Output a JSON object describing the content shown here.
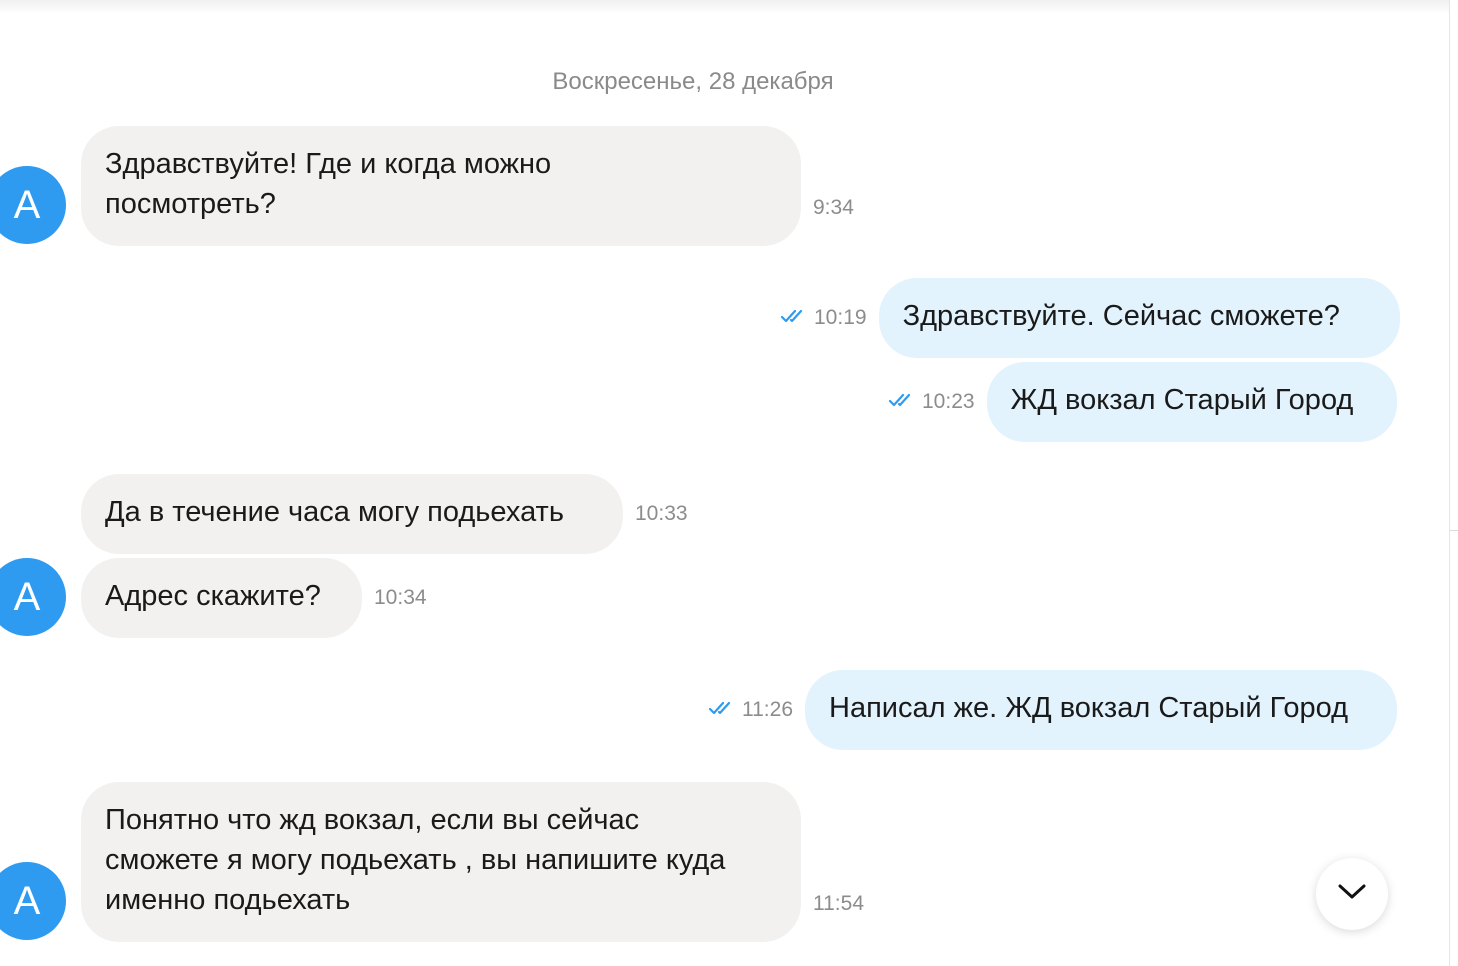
{
  "date_divider": "Воскресенье, 28 декабря",
  "avatar_letter": "А",
  "colors": {
    "avatar": "#2f9bf0",
    "incoming_bubble": "#f2f1f0",
    "outgoing_bubble": "#e2f3fd",
    "read_check": "#2f9bf0"
  },
  "messages": [
    {
      "direction": "incoming",
      "text_lines": [
        "Здравствуйте! Где и когда можно",
        "посмотреть?"
      ],
      "time": "9:34"
    },
    {
      "direction": "outgoing",
      "text": "Здравствуйте. Сейчас сможете?",
      "time": "10:19",
      "status": "read",
      "status_icon": "double-check-icon"
    },
    {
      "direction": "outgoing",
      "text": "ЖД вокзал Старый Город",
      "time": "10:23",
      "status": "read",
      "status_icon": "double-check-icon"
    },
    {
      "direction": "incoming",
      "text": "Да в течение часа могу подьехать",
      "time": "10:33"
    },
    {
      "direction": "incoming",
      "text": "Адрес скажите?",
      "time": "10:34"
    },
    {
      "direction": "outgoing",
      "text": "Написал же. ЖД вокзал Старый Город",
      "time": "11:26",
      "status": "read",
      "status_icon": "double-check-icon"
    },
    {
      "direction": "incoming",
      "text_lines": [
        "Понятно что жд вокзал, если вы сейчас",
        "сможете я могу подьехать , вы напишите куда",
        "именно подьехать"
      ],
      "time": "11:54"
    }
  ],
  "scroll_down_button": {
    "icon": "chevron-down-icon"
  }
}
